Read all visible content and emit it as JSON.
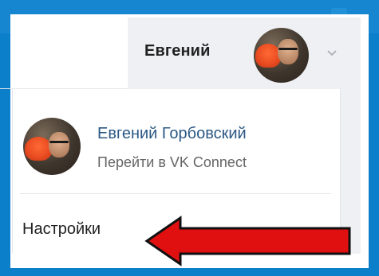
{
  "header": {
    "username": "Евгений"
  },
  "dropdown": {
    "full_name": "Евгений Горбовский",
    "vk_connect_link": "Перейти в VK Connect",
    "settings_label": "Настройки"
  },
  "colors": {
    "background_blue": "#0b7fc9",
    "link_blue": "#2a5885",
    "annotation_arrow": "#e01010",
    "arrow_outline": "#111111"
  },
  "icons": {
    "dropdown_toggle": "chevron-down-icon",
    "annotation": "arrow-left-icon"
  }
}
